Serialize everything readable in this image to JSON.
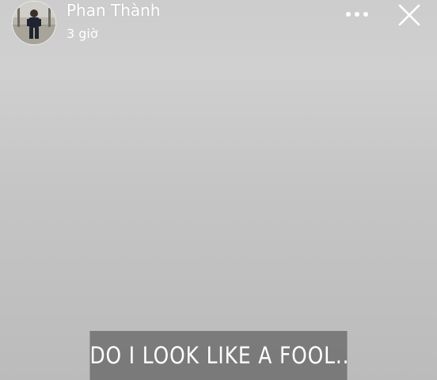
{
  "story": {
    "author_name": "Phan Thành",
    "timestamp": "3 giờ",
    "caption": "DO I LOOK LIKE A FOOL..",
    "icons": {
      "avatar": "profile-photo",
      "more": "more-dots-icon",
      "close": "close-icon"
    },
    "colors": {
      "background_top": "#dad9da",
      "background_bottom": "#bcbbbc",
      "caption_box": "#686868",
      "text": "#ffffff"
    }
  }
}
